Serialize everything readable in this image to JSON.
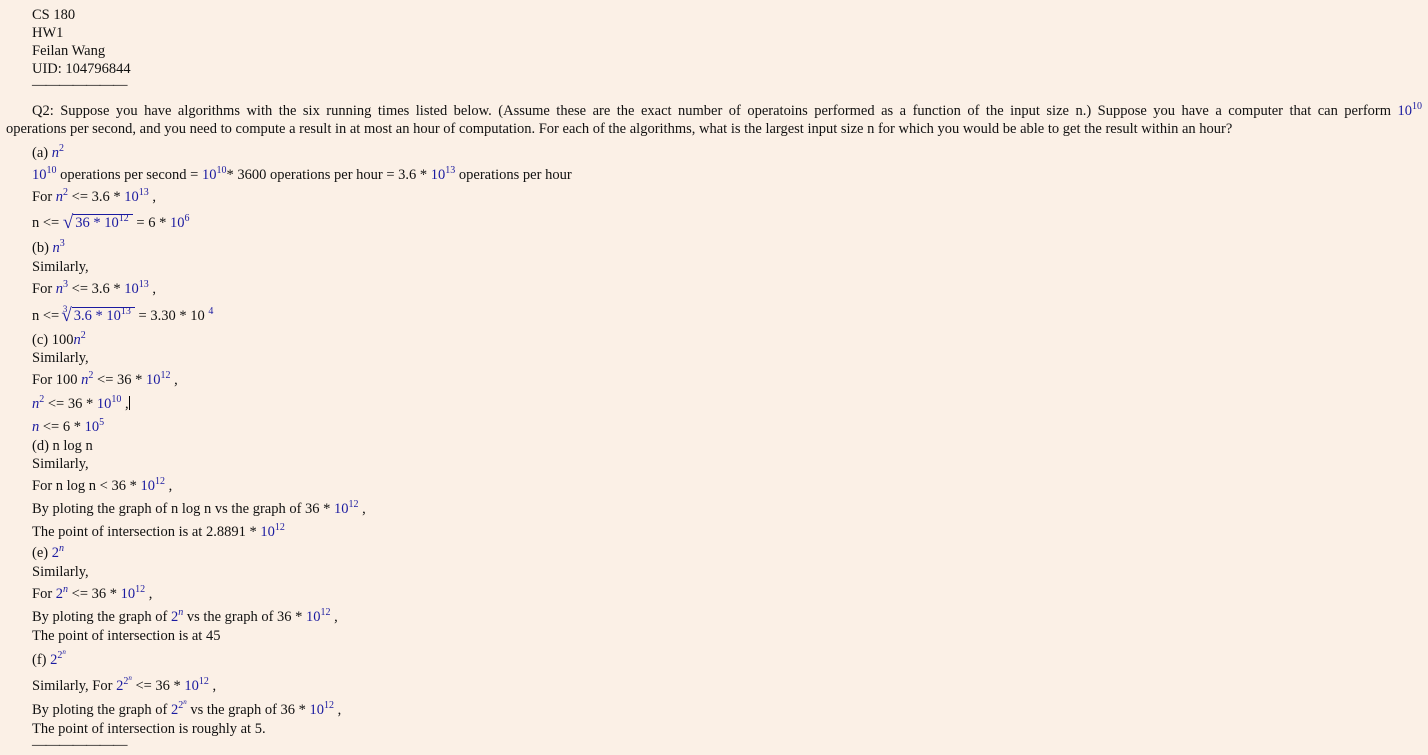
{
  "header": {
    "course": "CS 180",
    "hw": "HW1",
    "name": "Feilan Wang",
    "uid": "UID: 104796844",
    "divider": "———————"
  },
  "question": {
    "line1": "Q2: Suppose you have algorithms with the six running times listed below. (Assume these are the exact number of operatoins performed as a function of the input size n.) Suppose you have a computer that can perform",
    "line2": "operations per second, and you need to compute a result in at most an hour of computation. For each of the algorithms, what is the largest input size n for which you would be able to get the result within an hour?"
  },
  "parts": {
    "a_label": "(a)",
    "a_ops": "operations per second =",
    "a_hour": "* 3600 operations per hour = 3.6 *",
    "a_ophour": "operations per hour",
    "a_for": "For",
    "a_le": "<= 3.6 *",
    "a_n": "n <=",
    "a_sqrt_body": "36 * 10",
    "a_res": "= 6 *",
    "b_label": "(b)",
    "similarly": "Similarly,",
    "b_for": "For",
    "b_le": "<= 3.6 *",
    "b_n": "n <=",
    "b_root_body": "3.6 * 10",
    "b_res": "= 3.30 * 10",
    "c_label": "(c) 100",
    "c_for": "For 100",
    "c_le": "<= 36 *",
    "c_le2": "<= 36 *",
    "c_le3": "<= 6 *",
    "d_label": "(d) n log n",
    "d_for": "For n log n < 36 *",
    "d_plot": "By ploting the graph of n log n vs the graph of 36 *",
    "d_int": "The point of intersection is at 2.8891 *",
    "e_label": "(e)",
    "e_for": "For",
    "e_le": "<= 36 *",
    "e_plot1": "By ploting the graph of",
    "e_plot2": "vs the graph of 36 *",
    "e_int": "The point of intersection is at 45",
    "f_label": "(f)",
    "f_for": "Similarly, For",
    "f_le": "<= 36 *",
    "f_plot1": "By ploting the graph of",
    "f_plot2": "vs the graph of 36 *",
    "f_int": "The point of intersection is roughly at 5.",
    "divider": "———————"
  },
  "math": {
    "ten": "10",
    "two": "2",
    "n": "n",
    "three": "3",
    "exp10": "10",
    "exp12": "12",
    "exp13": "13",
    "exp6": "6",
    "exp5": "5",
    "exp4": "4",
    "expn": "n",
    "comma": ","
  }
}
